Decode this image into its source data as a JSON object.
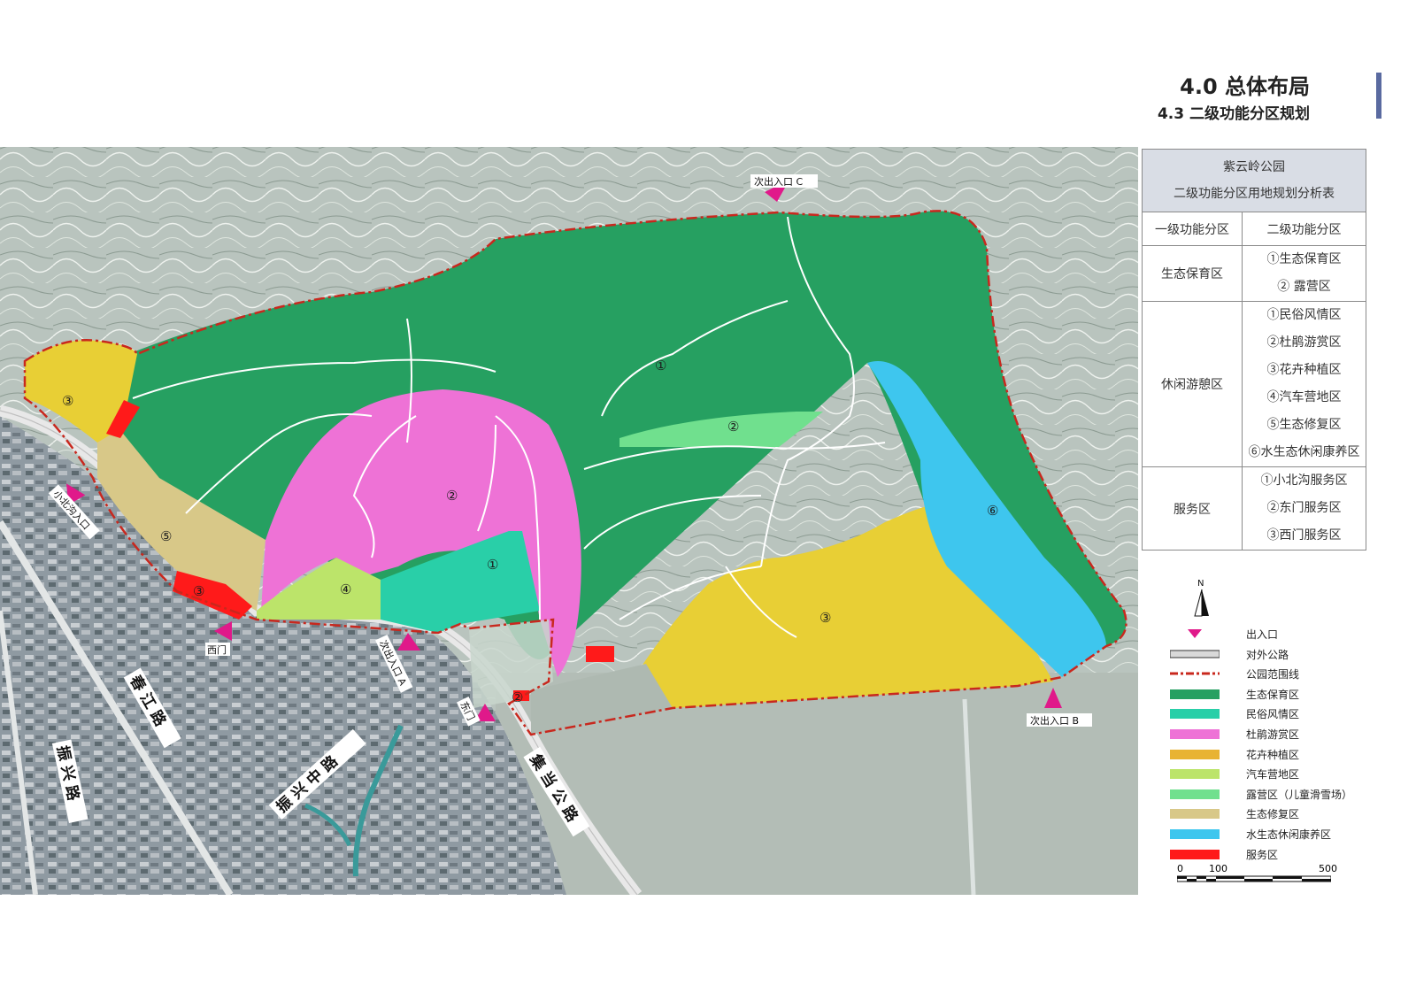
{
  "header": {
    "title": "4.0  总体布局",
    "subtitle": "4.3  二级功能分区规划"
  },
  "map": {
    "labels": {
      "zone_eco_1": "①",
      "zone_camp_2": "②",
      "zone_dujuan_2": "②",
      "zone_folk_1": "①",
      "zone_rv_4": "④",
      "zone_restore_5": "⑤",
      "zone_flower_3_west": "③",
      "zone_flower_3_east": "③",
      "zone_water_6": "⑥",
      "service_west_3": "③",
      "service_east_2": "②"
    },
    "entrances": {
      "c": "次出入口 C",
      "b": "次出入口 B",
      "a": "次出入口 A",
      "west": "西门",
      "east": "东门",
      "xiaobeigou": "小北沟入口"
    },
    "roads": {
      "chunjiang": "春 江 路",
      "zhenxing": "振 兴 路",
      "zhenxingzhong": "振 兴 中 路",
      "jidang": "集 当 公 路"
    }
  },
  "table": {
    "title_line1": "紫云岭公园",
    "title_line2": "二级功能分区用地规划分析表",
    "col1": "一级功能分区",
    "col2": "二级功能分区",
    "groups": [
      {
        "name": "生态保育区",
        "items": [
          "①生态保育区",
          "② 露营区"
        ]
      },
      {
        "name": "休闲游憩区",
        "items": [
          "①民俗风情区",
          "②杜鹃游赏区",
          "③花卉种植区",
          "④汽车营地区",
          "⑤生态修复区",
          "⑥水生态休闲康养区"
        ]
      },
      {
        "name": "服务区",
        "items": [
          "①小北沟服务区",
          "②东门服务区",
          "③西门服务区"
        ]
      }
    ]
  },
  "legend": {
    "north": "N",
    "items": [
      {
        "label": "出入口",
        "color": "#e0198a",
        "kind": "triangle"
      },
      {
        "label": "对外公路",
        "color": "#d9d9d9",
        "kind": "road"
      },
      {
        "label": "公园范围线",
        "color": "#c8281e",
        "kind": "dash"
      },
      {
        "label": "生态保育区",
        "color": "#26a061",
        "kind": "fill"
      },
      {
        "label": "民俗风情区",
        "color": "#29cfa8",
        "kind": "fill"
      },
      {
        "label": "杜鹃游赏区",
        "color": "#ee72d6",
        "kind": "fill"
      },
      {
        "label": "花卉种植区",
        "color": "#e8b332",
        "kind": "fill"
      },
      {
        "label": "汽车营地区",
        "color": "#bce46a",
        "kind": "fill"
      },
      {
        "label": "露营区（儿童滑雪场）",
        "color": "#70e08e",
        "kind": "fill"
      },
      {
        "label": "生态修复区",
        "color": "#d8c888",
        "kind": "fill"
      },
      {
        "label": "水生态休闲康养区",
        "color": "#3ec6ee",
        "kind": "fill"
      },
      {
        "label": "服务区",
        "color": "#ff1a1a",
        "kind": "fill"
      }
    ],
    "scale": {
      "zero": "0",
      "mid": "100",
      "end": "500"
    }
  }
}
